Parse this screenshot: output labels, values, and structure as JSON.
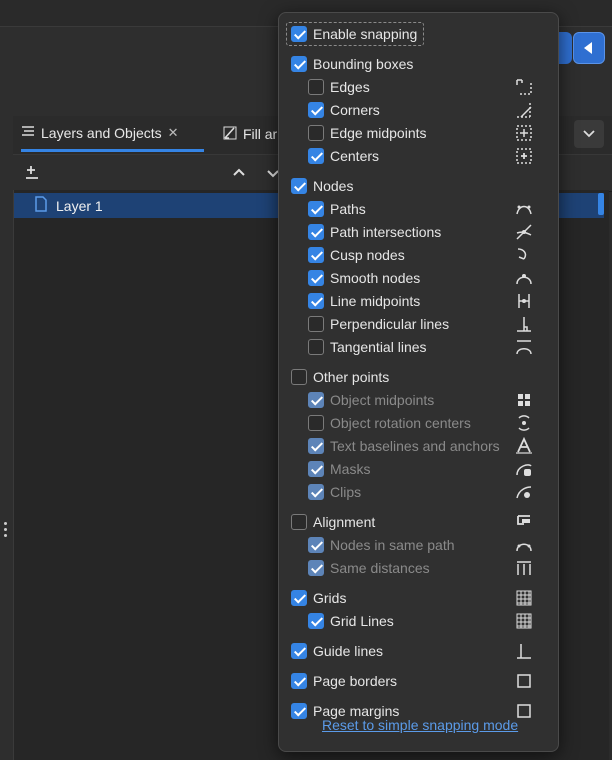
{
  "window": {
    "title": ""
  },
  "tabs": [
    {
      "label": "Layers and Objects",
      "icon": "layers-icon",
      "closable": true
    },
    {
      "label": "Fill ar",
      "icon": "brush-icon"
    }
  ],
  "layers": [
    {
      "label": "Layer 1",
      "icon": "layer-page-icon"
    }
  ],
  "snapping": {
    "enable": {
      "label": "Enable snapping",
      "checked": true
    },
    "groups": [
      {
        "label": "Bounding boxes",
        "checked": true,
        "items": [
          {
            "label": "Edges",
            "checked": false,
            "icon": "bbox-edges-icon"
          },
          {
            "label": "Corners",
            "checked": true,
            "icon": "bbox-corners-icon"
          },
          {
            "label": "Edge midpoints",
            "checked": false,
            "icon": "bbox-edge-midpoints-icon"
          },
          {
            "label": "Centers",
            "checked": true,
            "icon": "bbox-centers-icon"
          }
        ]
      },
      {
        "label": "Nodes",
        "checked": true,
        "items": [
          {
            "label": "Paths",
            "checked": true,
            "icon": "paths-icon"
          },
          {
            "label": "Path intersections",
            "checked": true,
            "icon": "path-intersections-icon"
          },
          {
            "label": "Cusp nodes",
            "checked": true,
            "icon": "cusp-nodes-icon"
          },
          {
            "label": "Smooth nodes",
            "checked": true,
            "icon": "smooth-nodes-icon"
          },
          {
            "label": "Line midpoints",
            "checked": true,
            "icon": "line-midpoints-icon"
          },
          {
            "label": "Perpendicular lines",
            "checked": false,
            "icon": "perpendicular-lines-icon"
          },
          {
            "label": "Tangential lines",
            "checked": false,
            "icon": "tangential-lines-icon"
          }
        ]
      },
      {
        "label": "Other points",
        "checked": false,
        "items": [
          {
            "label": "Object midpoints",
            "checked": true,
            "icon": "object-midpoints-icon"
          },
          {
            "label": "Object rotation centers",
            "checked": false,
            "icon": "rotation-centers-icon"
          },
          {
            "label": "Text baselines and anchors",
            "checked": true,
            "icon": "text-baselines-icon"
          },
          {
            "label": "Masks",
            "checked": true,
            "icon": "masks-icon"
          },
          {
            "label": "Clips",
            "checked": true,
            "icon": "clips-icon"
          }
        ]
      },
      {
        "label": "Alignment",
        "checked": false,
        "icon": "alignment-icon",
        "items": [
          {
            "label": "Nodes in same path",
            "checked": true,
            "icon": "nodes-same-path-icon"
          },
          {
            "label": "Same distances",
            "checked": true,
            "icon": "same-distances-icon"
          }
        ]
      },
      {
        "label": "Grids",
        "checked": true,
        "icon": "grid-icon",
        "items": [
          {
            "label": "Grid Lines",
            "checked": true,
            "icon": "grid-lines-icon"
          }
        ]
      },
      {
        "label": "Guide lines",
        "checked": true,
        "icon": "guide-lines-icon",
        "items": []
      },
      {
        "label": "Page borders",
        "checked": true,
        "icon": "page-borders-icon",
        "items": []
      },
      {
        "label": "Page margins",
        "checked": true,
        "icon": "page-margins-icon",
        "items": []
      }
    ],
    "reset_link": "Reset to simple snapping mode"
  },
  "colors": {
    "accent": "#3584e4",
    "selection": "#1e4275",
    "popover_bg": "#303030",
    "link": "#5b9be9"
  }
}
